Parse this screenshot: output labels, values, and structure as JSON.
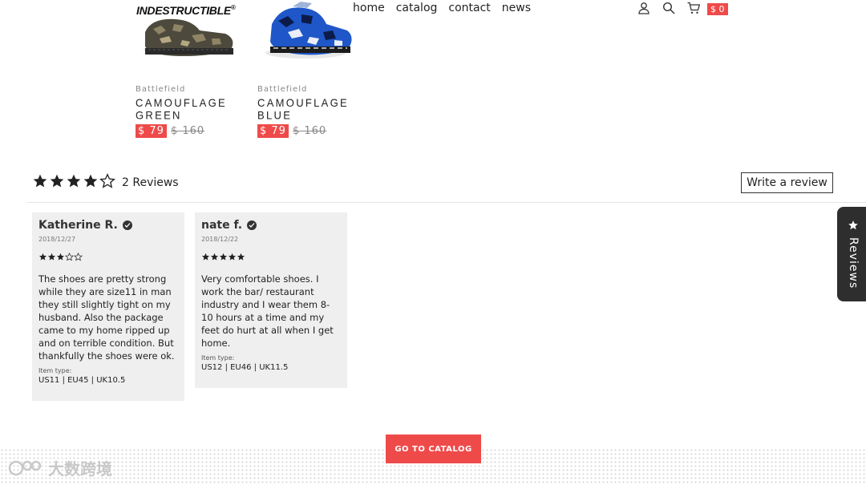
{
  "header": {
    "logo": "INDESTRUCTIBLE",
    "logo_reg": "®",
    "nav": [
      "home",
      "catalog",
      "contact",
      "news"
    ],
    "cart_total": "$ 0",
    "icons": [
      "user-icon",
      "search-icon",
      "cart-icon"
    ]
  },
  "products": [
    {
      "brand": "Battlefield",
      "name": "CAMOUFLAGE GREEN",
      "sale_price": "$ 79",
      "original_price": "$ 160"
    },
    {
      "brand": "Battlefield",
      "name": "CAMOUFLAGE BLUE",
      "sale_price": "$ 79",
      "original_price": "$ 160"
    }
  ],
  "reviews_summary": {
    "rating": 4,
    "max_rating": 5,
    "count_label": "2 Reviews",
    "write_button": "Write a review"
  },
  "reviews": [
    {
      "name": "Katherine R.",
      "date": "2018/12/27",
      "rating": 3,
      "text": "The shoes are pretty strong while they are size11 in man they still slightly tight on my husband. Also the package came to my home ripped up and on terrible condition. But thankfully the shoes were ok.",
      "item_type_label": "Item type:",
      "item_type": "US11 | EU45 | UK10.5"
    },
    {
      "name": "nate f.",
      "date": "2018/12/22",
      "rating": 5,
      "text": "Very comfortable shoes. I work the bar/ restaurant industry and I wear them 8-10 hours at a time and my feet do hurt at all when I get home.",
      "item_type_label": "Item type:",
      "item_type": "US12 | EU46 | UK11.5"
    }
  ],
  "side_tab": {
    "label": "Reviews"
  },
  "cta": {
    "label": "GO TO CATALOG"
  },
  "watermark": {
    "text": "大数跨境"
  },
  "colors": {
    "accent": "#ef4a4a",
    "dark": "#2e2e2e",
    "card_bg": "#efefef"
  }
}
